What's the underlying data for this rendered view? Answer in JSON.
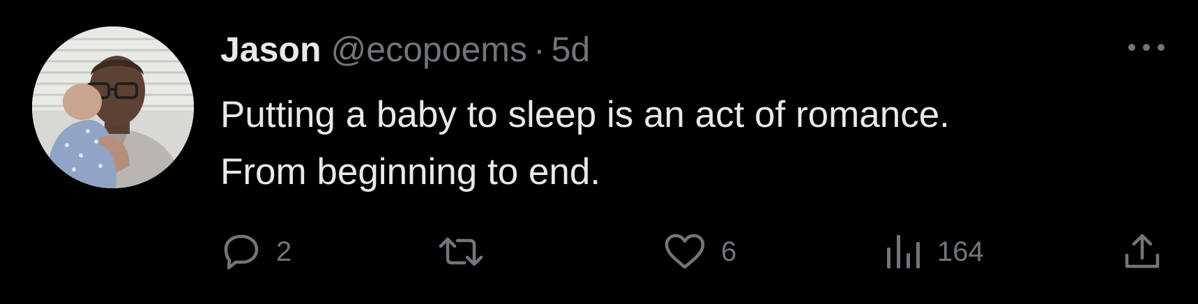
{
  "tweet": {
    "display_name": "Jason",
    "handle": "@ecopoems",
    "separator": "·",
    "time": "5d",
    "text": "Putting a baby to sleep is an act of romance.\nFrom beginning to end.",
    "avatar": "profile-photo"
  },
  "actions": {
    "replies": "2",
    "retweets": "",
    "likes": "6",
    "views": "164"
  },
  "icons": {
    "more": "more-horizontal-icon",
    "reply": "reply-bubble-icon",
    "retweet": "retweet-arrows-icon",
    "like": "heart-icon",
    "views": "bar-chart-icon",
    "share": "share-upload-icon"
  },
  "colors": {
    "background": "#000000",
    "primary_text": "#e7e9ea",
    "secondary_text": "#71767b"
  }
}
